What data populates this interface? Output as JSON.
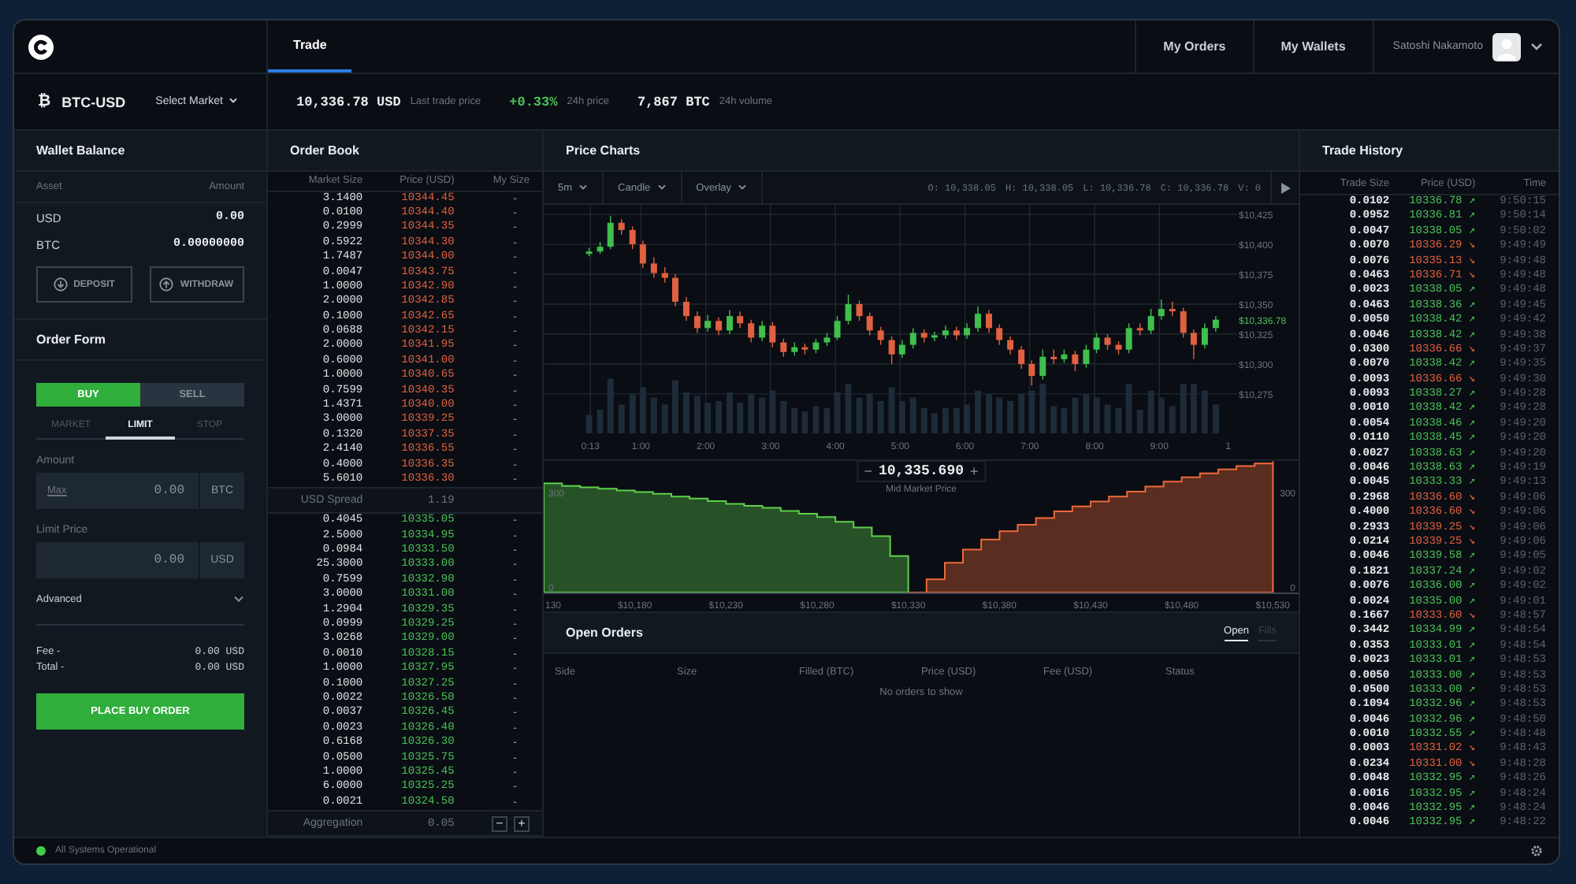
{
  "header": {
    "tabs": [
      {
        "label": "Trade",
        "selected": true
      }
    ],
    "nav": [
      "My Orders",
      "My Wallets"
    ],
    "user": "Satoshi Nakamoto"
  },
  "market": {
    "symbol": "₿",
    "pair": "BTC-USD",
    "select": "Select Market",
    "stats": [
      {
        "value": "10,336.78 USD",
        "label": "Last trade price",
        "positive": false
      },
      {
        "value": "+0.33%",
        "label": "24h price",
        "positive": true
      },
      {
        "value": "7,867 BTC",
        "label": "24h volume",
        "positive": false
      }
    ]
  },
  "wallet": {
    "title": "Wallet Balance",
    "columns": [
      "Asset",
      "Amount"
    ],
    "rows": [
      {
        "asset": "USD",
        "amount": "0.00"
      },
      {
        "asset": "BTC",
        "amount": "0.00000000"
      }
    ],
    "buttons": [
      {
        "label": "DEPOSIT",
        "kind": "deposit"
      },
      {
        "label": "WITHDRAW",
        "kind": "withdraw"
      }
    ]
  },
  "order_form": {
    "title": "Order Form",
    "sides": [
      {
        "label": "BUY",
        "selected": true
      },
      {
        "label": "SELL",
        "selected": false
      }
    ],
    "types": [
      {
        "label": "MARKET",
        "selected": false
      },
      {
        "label": "LIMIT",
        "selected": true
      },
      {
        "label": "STOP",
        "selected": false
      }
    ],
    "fields": [
      {
        "label": "Amount",
        "link": "Max",
        "placeholder": "0.00",
        "unit": "BTC"
      },
      {
        "label": "Limit Price",
        "placeholder": "0.00",
        "unit": "USD"
      }
    ],
    "advanced": "Advanced",
    "totals": [
      {
        "label": "Fee -",
        "value": "0.00 USD"
      },
      {
        "label": "Total -",
        "value": "0.00 USD"
      }
    ],
    "submit": "PLACE BUY ORDER"
  },
  "order_book": {
    "title": "Order Book",
    "columns": [
      "Market Size",
      "Price (USD)",
      "My Size"
    ],
    "asks": [
      {
        "size": "3.1400",
        "price": "10344.45",
        "mine": "-"
      },
      {
        "size": "0.0100",
        "price": "10344.40",
        "mine": "-"
      },
      {
        "size": "0.2999",
        "price": "10344.35",
        "mine": "-"
      },
      {
        "size": "0.5922",
        "price": "10344.30",
        "mine": "-"
      },
      {
        "size": "1.7487",
        "price": "10344.00",
        "mine": "-"
      },
      {
        "size": "0.0047",
        "price": "10343.75",
        "mine": "-"
      },
      {
        "size": "1.0000",
        "price": "10342.90",
        "mine": "-"
      },
      {
        "size": "2.0000",
        "price": "10342.85",
        "mine": "-"
      },
      {
        "size": "0.1000",
        "price": "10342.65",
        "mine": "-"
      },
      {
        "size": "0.0688",
        "price": "10342.15",
        "mine": "-"
      },
      {
        "size": "2.0000",
        "price": "10341.95",
        "mine": "-"
      },
      {
        "size": "0.6000",
        "price": "10341.00",
        "mine": "-"
      },
      {
        "size": "1.0000",
        "price": "10340.65",
        "mine": "-"
      },
      {
        "size": "0.7599",
        "price": "10340.35",
        "mine": "-"
      },
      {
        "size": "1.4371",
        "price": "10340.00",
        "mine": "-"
      },
      {
        "size": "3.0000",
        "price": "10339.25",
        "mine": "-"
      },
      {
        "size": "0.1320",
        "price": "10337.35",
        "mine": "-"
      },
      {
        "size": "2.4140",
        "price": "10336.55",
        "mine": "-"
      },
      {
        "size": "0.4000",
        "price": "10336.35",
        "mine": "-"
      },
      {
        "size": "5.6010",
        "price": "10336.30",
        "mine": "-"
      }
    ],
    "spread": {
      "label": "USD Spread",
      "value": "1.19"
    },
    "bids": [
      {
        "size": "0.4045",
        "price": "10335.05",
        "mine": "-"
      },
      {
        "size": "2.5000",
        "price": "10334.95",
        "mine": "-"
      },
      {
        "size": "0.0984",
        "price": "10333.50",
        "mine": "-"
      },
      {
        "size": "25.3000",
        "price": "10333.00",
        "mine": "-"
      },
      {
        "size": "0.7599",
        "price": "10332.90",
        "mine": "-"
      },
      {
        "size": "3.0000",
        "price": "10331.00",
        "mine": "-"
      },
      {
        "size": "1.2904",
        "price": "10329.35",
        "mine": "-"
      },
      {
        "size": "0.0999",
        "price": "10329.25",
        "mine": "-"
      },
      {
        "size": "3.0268",
        "price": "10329.00",
        "mine": "-"
      },
      {
        "size": "0.0010",
        "price": "10328.15",
        "mine": "-"
      },
      {
        "size": "1.0000",
        "price": "10327.95",
        "mine": "-"
      },
      {
        "size": "0.1000",
        "price": "10327.25",
        "mine": "-"
      },
      {
        "size": "0.0022",
        "price": "10326.50",
        "mine": "-"
      },
      {
        "size": "0.0037",
        "price": "10326.45",
        "mine": "-"
      },
      {
        "size": "0.0023",
        "price": "10326.40",
        "mine": "-"
      },
      {
        "size": "0.6168",
        "price": "10326.30",
        "mine": "-"
      },
      {
        "size": "0.0500",
        "price": "10325.75",
        "mine": "-"
      },
      {
        "size": "1.0000",
        "price": "10325.45",
        "mine": "-"
      },
      {
        "size": "6.0000",
        "price": "10325.25",
        "mine": "-"
      },
      {
        "size": "0.0021",
        "price": "10324.50",
        "mine": "-"
      }
    ],
    "aggregation": {
      "label": "Aggregation",
      "value": "0.05",
      "minus": "−",
      "plus": "+"
    }
  },
  "price_charts": {
    "title": "Price Charts",
    "dropdowns": [
      "5m",
      "Candle",
      "Overlay"
    ],
    "ohlcv": [
      "O: 10,338.05",
      "H: 10,338.05",
      "L: 10,336.78",
      "C: 10,336.78",
      "V:  0"
    ],
    "chart_data": {
      "type": "candlestick",
      "x": [
        0.2,
        0.37,
        0.53,
        0.7,
        0.87,
        1.03,
        1.2,
        1.37,
        1.53,
        1.7,
        1.87,
        2.03,
        2.2,
        2.37,
        2.53,
        2.7,
        2.87,
        3.03,
        3.2,
        3.37,
        3.53,
        3.7,
        3.87,
        4.03,
        4.2,
        4.37,
        4.53,
        4.7,
        4.87,
        5.03,
        5.2,
        5.37,
        5.53,
        5.7,
        5.87,
        6.03,
        6.2,
        6.37,
        6.53,
        6.7,
        6.87,
        7.03,
        7.2,
        7.37,
        7.53,
        7.7,
        7.87,
        8.03,
        8.2,
        8.37,
        8.53,
        8.7,
        8.87,
        9.03,
        9.2,
        9.37,
        9.53,
        9.7,
        9.87
      ],
      "ohlc": [
        [
          10392,
          10397,
          10390,
          10394
        ],
        [
          10394,
          10402,
          10392,
          10398
        ],
        [
          10398,
          10424,
          10396,
          10418
        ],
        [
          10418,
          10421,
          10408,
          10412
        ],
        [
          10412,
          10415,
          10396,
          10400
        ],
        [
          10400,
          10403,
          10380,
          10384
        ],
        [
          10384,
          10389,
          10372,
          10376
        ],
        [
          10376,
          10381,
          10368,
          10372
        ],
        [
          10372,
          10375,
          10348,
          10352
        ],
        [
          10352,
          10356,
          10336,
          10340
        ],
        [
          10340,
          10344,
          10326,
          10330
        ],
        [
          10330,
          10341,
          10327,
          10336
        ],
        [
          10336,
          10339,
          10324,
          10328
        ],
        [
          10328,
          10345,
          10325,
          10340
        ],
        [
          10340,
          10344,
          10330,
          10334
        ],
        [
          10334,
          10337,
          10318,
          10322
        ],
        [
          10322,
          10336,
          10319,
          10332
        ],
        [
          10332,
          10335,
          10314,
          10318
        ],
        [
          10318,
          10321,
          10306,
          10310
        ],
        [
          10310,
          10318,
          10307,
          10314
        ],
        [
          10314,
          10317,
          10308,
          10312
        ],
        [
          10312,
          10321,
          10309,
          10318
        ],
        [
          10318,
          10326,
          10315,
          10322
        ],
        [
          10322,
          10340,
          10320,
          10336
        ],
        [
          10336,
          10358,
          10333,
          10350
        ],
        [
          10350,
          10353,
          10336,
          10340
        ],
        [
          10340,
          10343,
          10324,
          10328
        ],
        [
          10328,
          10331,
          10316,
          10320
        ],
        [
          10320,
          10323,
          10300,
          10308
        ],
        [
          10308,
          10320,
          10305,
          10316
        ],
        [
          10316,
          10330,
          10313,
          10326
        ],
        [
          10326,
          10329,
          10318,
          10322
        ],
        [
          10322,
          10327,
          10319,
          10324
        ],
        [
          10324,
          10332,
          10321,
          10328
        ],
        [
          10328,
          10331,
          10320,
          10324
        ],
        [
          10324,
          10334,
          10321,
          10330
        ],
        [
          10330,
          10348,
          10327,
          10342
        ],
        [
          10342,
          10345,
          10326,
          10330
        ],
        [
          10330,
          10333,
          10316,
          10320
        ],
        [
          10320,
          10323,
          10308,
          10312
        ],
        [
          10312,
          10315,
          10296,
          10300
        ],
        [
          10300,
          10303,
          10282,
          10290
        ],
        [
          10290,
          10312,
          10287,
          10306
        ],
        [
          10306,
          10312,
          10300,
          10304
        ],
        [
          10304,
          10312,
          10301,
          10308
        ],
        [
          10308,
          10311,
          10294,
          10300
        ],
        [
          10300,
          10316,
          10297,
          10312
        ],
        [
          10312,
          10326,
          10309,
          10322
        ],
        [
          10322,
          10325,
          10312,
          10316
        ],
        [
          10316,
          10319,
          10308,
          10312
        ],
        [
          10312,
          10334,
          10309,
          10330
        ],
        [
          10330,
          10334,
          10324,
          10328
        ],
        [
          10328,
          10346,
          10325,
          10340
        ],
        [
          10340,
          10354,
          10337,
          10346
        ],
        [
          10346,
          10352,
          10340,
          10344
        ],
        [
          10344,
          10347,
          10322,
          10326
        ],
        [
          10326,
          10329,
          10304,
          10316
        ],
        [
          10316,
          10334,
          10313,
          10330
        ],
        [
          10330,
          10340,
          10327,
          10337
        ]
      ],
      "xlim": [
        -0.5,
        10.2
      ],
      "ylim": [
        10242,
        10433
      ],
      "grid": true,
      "yticks": [
        {
          "value": 10425,
          "label": "$10,425"
        },
        {
          "value": 10400,
          "label": "$10,400"
        },
        {
          "value": 10375,
          "label": "$10,375"
        },
        {
          "value": 10350,
          "label": "$10,350"
        },
        {
          "value": 10325,
          "label": "$10,325"
        },
        {
          "value": 10300,
          "label": "$10,300"
        },
        {
          "value": 10275,
          "label": "$10,275"
        }
      ],
      "xticks": [
        {
          "value": 0.22,
          "label": "0:13"
        },
        {
          "value": 1,
          "label": "1:00"
        },
        {
          "value": 2,
          "label": "2:00"
        },
        {
          "value": 3,
          "label": "3:00"
        },
        {
          "value": 4,
          "label": "4:00"
        },
        {
          "value": 5,
          "label": "5:00"
        },
        {
          "value": 6,
          "label": "6:00"
        },
        {
          "value": 7,
          "label": "7:00"
        },
        {
          "value": 8,
          "label": "8:00"
        },
        {
          "value": 9,
          "label": "9:00"
        }
      ]
    },
    "x_edge_label": "1",
    "last_price": "$10,336.78",
    "depth": {
      "mid": "10,335.690",
      "minus": "−",
      "plus": "+",
      "label": "Mid Market Price",
      "right_ticks": [
        "300",
        "0"
      ],
      "x_edge_label": "130",
      "chart_data": {
        "type": "area",
        "x": [
          10130,
          10140,
          10150,
          10160,
          10170,
          10180,
          10190,
          10200,
          10210,
          10220,
          10230,
          10240,
          10250,
          10260,
          10270,
          10280,
          10290,
          10300,
          10310,
          10320,
          10330,
          10340,
          10350,
          10360,
          10370,
          10380,
          10390,
          10400,
          10410,
          10420,
          10430,
          10440,
          10450,
          10460,
          10470,
          10480,
          10490,
          10500,
          10510,
          10520,
          10530
        ],
        "series": [
          {
            "color": "#5ed04d",
            "values": [
              330,
              322,
              318,
              314,
              308,
              304,
              298,
              290,
              284,
              276,
              268,
              262,
              256,
              246,
              238,
              228,
              214,
              196,
              170,
              110,
              0,
              null,
              null,
              null,
              null,
              null,
              null,
              null,
              null,
              null,
              null,
              null,
              null,
              null,
              null,
              null,
              null,
              null,
              null,
              null,
              null
            ]
          },
          {
            "color": "#ee6a3a",
            "values": [
              null,
              null,
              null,
              null,
              null,
              null,
              null,
              null,
              null,
              null,
              null,
              null,
              null,
              null,
              null,
              null,
              null,
              null,
              null,
              null,
              0,
              40,
              90,
              130,
              160,
              185,
              205,
              225,
              245,
              260,
              275,
              290,
              305,
              320,
              335,
              348,
              360,
              372,
              382,
              390,
              396
            ]
          }
        ],
        "xlim": [
          10130,
          10545
        ],
        "ylim": [
          0,
          400
        ],
        "yticks": [
          300,
          0
        ],
        "xticks": [
          {
            "value": 10180,
            "label": "$10,180"
          },
          {
            "value": 10230,
            "label": "$10,230"
          },
          {
            "value": 10280,
            "label": "$10,280"
          },
          {
            "value": 10330,
            "label": "$10,330"
          },
          {
            "value": 10380,
            "label": "$10,380"
          },
          {
            "value": 10430,
            "label": "$10,430"
          },
          {
            "value": 10480,
            "label": "$10,480"
          },
          {
            "value": 10530,
            "label": "$10,530"
          }
        ]
      }
    }
  },
  "open_orders": {
    "title": "Open Orders",
    "tabs": [
      {
        "label": "Open",
        "selected": true
      },
      {
        "label": "Fills",
        "selected": false
      }
    ],
    "columns": [
      "Side",
      "Size",
      "Filled (BTC)",
      "Price (USD)",
      "Fee (USD)",
      "Status"
    ],
    "empty": "No orders to show"
  },
  "trade_history": {
    "title": "Trade History",
    "columns": [
      "Trade Size",
      "Price (USD)",
      "Time"
    ],
    "rows": [
      {
        "size": "0.0102",
        "price": "10336.78",
        "arrow": "↗",
        "buy": true,
        "time": "9:50:15"
      },
      {
        "size": "0.0952",
        "price": "10336.81",
        "arrow": "↗",
        "buy": true,
        "time": "9:50:14"
      },
      {
        "size": "0.0047",
        "price": "10338.05",
        "arrow": "↗",
        "buy": true,
        "time": "9:50:02"
      },
      {
        "size": "0.0070",
        "price": "10336.29",
        "arrow": "↘",
        "buy": false,
        "time": "9:49:49"
      },
      {
        "size": "0.0076",
        "price": "10335.13",
        "arrow": "↘",
        "buy": false,
        "time": "9:49:48"
      },
      {
        "size": "0.0463",
        "price": "10336.71",
        "arrow": "↘",
        "buy": false,
        "time": "9:49:48"
      },
      {
        "size": "0.0023",
        "price": "10338.05",
        "arrow": "↗",
        "buy": true,
        "time": "9:49:48"
      },
      {
        "size": "0.0463",
        "price": "10338.36",
        "arrow": "↗",
        "buy": true,
        "time": "9:49:45"
      },
      {
        "size": "0.0050",
        "price": "10338.42",
        "arrow": "↗",
        "buy": true,
        "time": "9:49:42"
      },
      {
        "size": "0.0046",
        "price": "10338.42",
        "arrow": "↗",
        "buy": true,
        "time": "9:49:38"
      },
      {
        "size": "0.0300",
        "price": "10336.66",
        "arrow": "↘",
        "buy": false,
        "time": "9:49:37"
      },
      {
        "size": "0.0070",
        "price": "10338.42",
        "arrow": "↗",
        "buy": true,
        "time": "9:49:35"
      },
      {
        "size": "0.0093",
        "price": "10336.66",
        "arrow": "↘",
        "buy": false,
        "time": "9:49:30"
      },
      {
        "size": "0.0093",
        "price": "10338.27",
        "arrow": "↗",
        "buy": true,
        "time": "9:49:28"
      },
      {
        "size": "0.0010",
        "price": "10338.42",
        "arrow": "↗",
        "buy": true,
        "time": "9:49:28"
      },
      {
        "size": "0.0054",
        "price": "10338.46",
        "arrow": "↗",
        "buy": true,
        "time": "9:49:20"
      },
      {
        "size": "0.0110",
        "price": "10338.45",
        "arrow": "↗",
        "buy": true,
        "time": "9:49:20"
      },
      {
        "size": "0.0027",
        "price": "10338.63",
        "arrow": "↗",
        "buy": true,
        "time": "9:49:20"
      },
      {
        "size": "0.0046",
        "price": "10338.63",
        "arrow": "↗",
        "buy": true,
        "time": "9:49:19"
      },
      {
        "size": "0.0045",
        "price": "10333.33",
        "arrow": "↗",
        "buy": true,
        "time": "9:49:13"
      },
      {
        "size": "0.2968",
        "price": "10336.60",
        "arrow": "↘",
        "buy": false,
        "time": "9:49:06"
      },
      {
        "size": "0.4000",
        "price": "10336.60",
        "arrow": "↘",
        "buy": false,
        "time": "9:49:06"
      },
      {
        "size": "0.2933",
        "price": "10339.25",
        "arrow": "↘",
        "buy": false,
        "time": "9:49:06"
      },
      {
        "size": "0.0214",
        "price": "10339.25",
        "arrow": "↘",
        "buy": false,
        "time": "9:49:06"
      },
      {
        "size": "0.0046",
        "price": "10339.58",
        "arrow": "↗",
        "buy": true,
        "time": "9:49:05"
      },
      {
        "size": "0.1821",
        "price": "10337.24",
        "arrow": "↗",
        "buy": true,
        "time": "9:49:02"
      },
      {
        "size": "0.0076",
        "price": "10336.00",
        "arrow": "↗",
        "buy": true,
        "time": "9:49:02"
      },
      {
        "size": "0.0024",
        "price": "10335.00",
        "arrow": "↗",
        "buy": true,
        "time": "9:49:01"
      },
      {
        "size": "0.1667",
        "price": "10333.60",
        "arrow": "↘",
        "buy": false,
        "time": "9:48:57"
      },
      {
        "size": "0.3442",
        "price": "10334.99",
        "arrow": "↗",
        "buy": true,
        "time": "9:48:54"
      },
      {
        "size": "0.0353",
        "price": "10333.01",
        "arrow": "↗",
        "buy": true,
        "time": "9:48:54"
      },
      {
        "size": "0.0023",
        "price": "10333.01",
        "arrow": "↗",
        "buy": true,
        "time": "9:48:53"
      },
      {
        "size": "0.0050",
        "price": "10333.00",
        "arrow": "↗",
        "buy": true,
        "time": "9:48:53"
      },
      {
        "size": "0.0500",
        "price": "10333.00",
        "arrow": "↗",
        "buy": true,
        "time": "9:48:53"
      },
      {
        "size": "0.1094",
        "price": "10332.96",
        "arrow": "↗",
        "buy": true,
        "time": "9:48:53"
      },
      {
        "size": "0.0046",
        "price": "10332.96",
        "arrow": "↗",
        "buy": true,
        "time": "9:48:50"
      },
      {
        "size": "0.0010",
        "price": "10332.55",
        "arrow": "↗",
        "buy": true,
        "time": "9:48:48"
      },
      {
        "size": "0.0003",
        "price": "10331.02",
        "arrow": "↘",
        "buy": false,
        "time": "9:48:43"
      },
      {
        "size": "0.0234",
        "price": "10331.00",
        "arrow": "↘",
        "buy": false,
        "time": "9:48:28"
      },
      {
        "size": "0.0048",
        "price": "10332.95",
        "arrow": "↗",
        "buy": true,
        "time": "9:48:26"
      },
      {
        "size": "0.0016",
        "price": "10332.95",
        "arrow": "↗",
        "buy": true,
        "time": "9:48:24"
      },
      {
        "size": "0.0046",
        "price": "10332.95",
        "arrow": "↗",
        "buy": true,
        "time": "9:48:24"
      },
      {
        "size": "0.0046",
        "price": "10332.95",
        "arrow": "↗",
        "buy": true,
        "time": "9:48:22"
      }
    ]
  },
  "status_bar": {
    "text": "All Systems Operational",
    "ok": true
  }
}
